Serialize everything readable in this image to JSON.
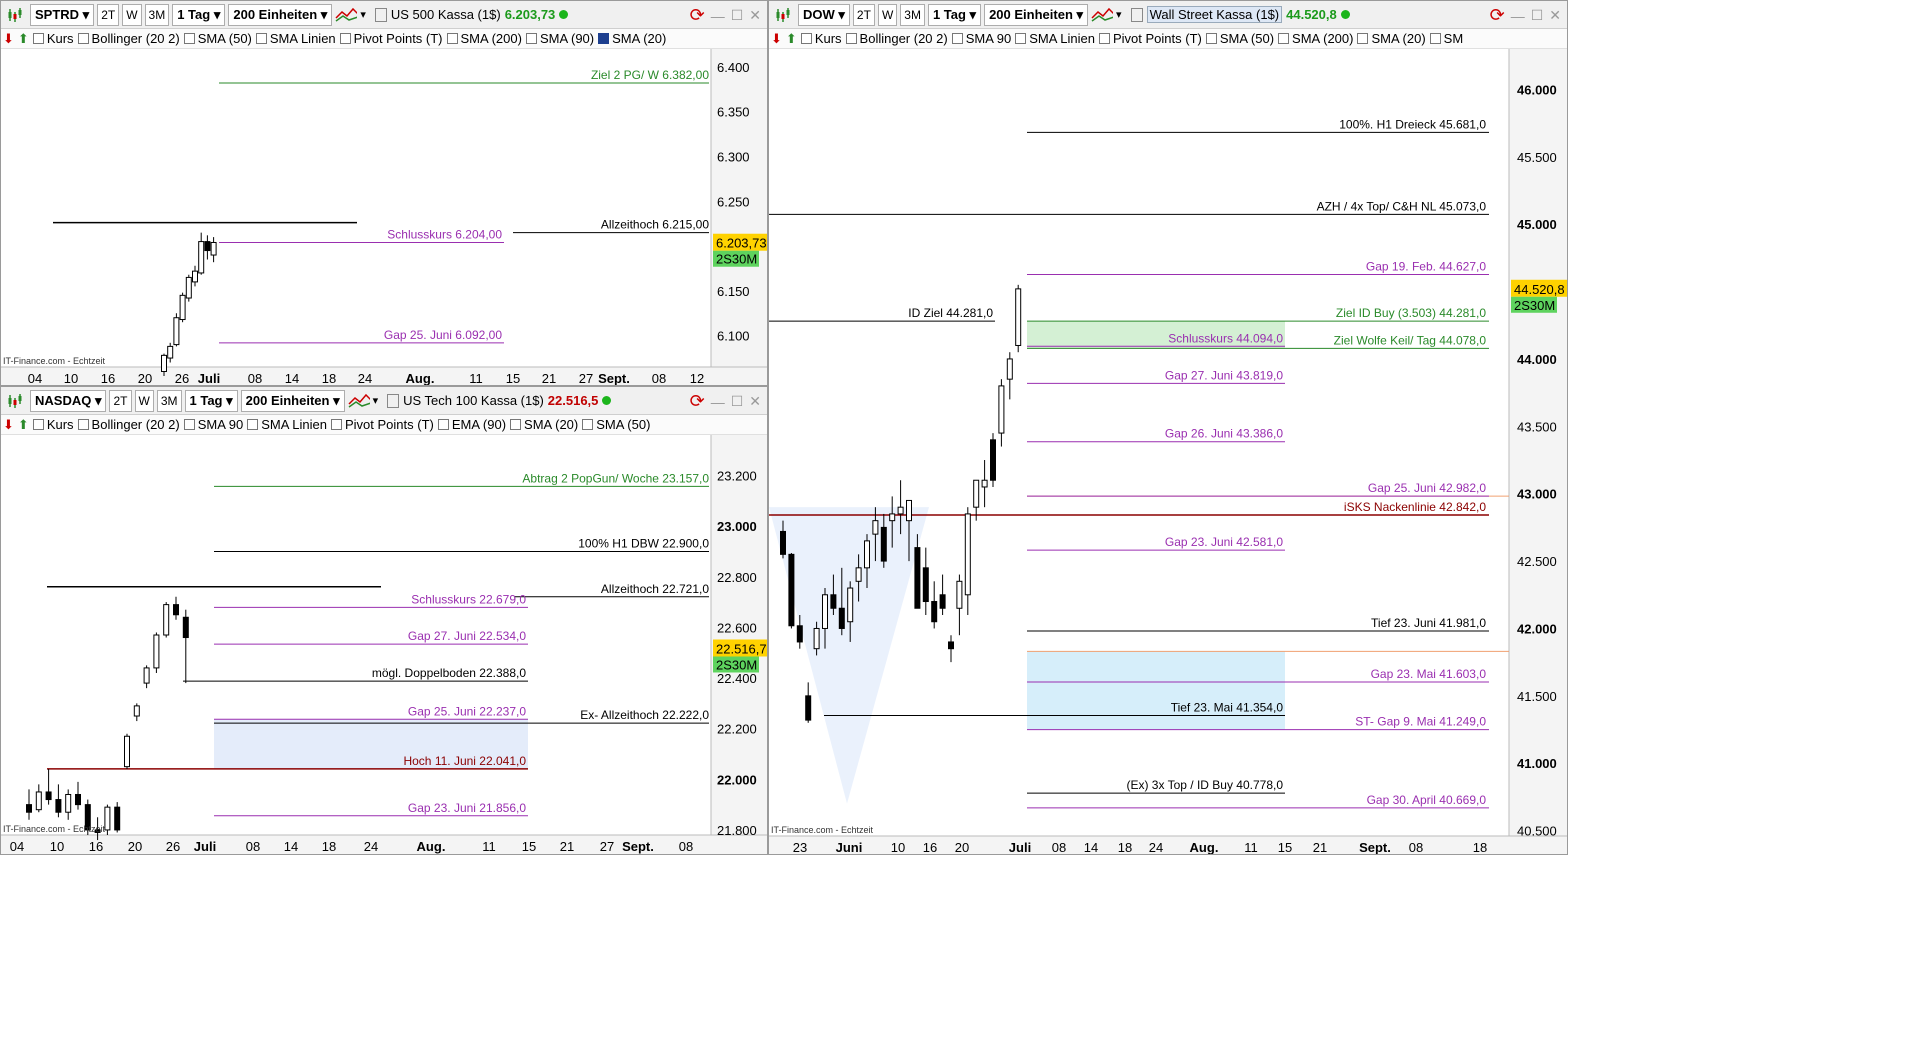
{
  "panels": {
    "sp": {
      "symbol": "SPTRD",
      "periods": [
        "2T",
        "W",
        "3M"
      ],
      "interval": "1 Tag",
      "units": "200 Einheiten",
      "instrument": "US 500 Kassa (1$)",
      "price": "6.203,73",
      "indicators": [
        "Kurs",
        "Bollinger (20 2)",
        "SMA (50)",
        "SMA Linien",
        "Pivot Points (T)",
        "SMA (200)",
        "SMA (90)",
        "SMA (20)"
      ],
      "watermark": "IT-Finance.com - Echtzeit",
      "price_tag": "6.203,73",
      "tag_sub": "2S30M"
    },
    "nq": {
      "symbol": "NASDAQ",
      "periods": [
        "2T",
        "W",
        "3M"
      ],
      "interval": "1 Tag",
      "units": "200 Einheiten",
      "instrument": "US Tech 100 Kassa (1$)",
      "price": "22.516,5",
      "indicators": [
        "Kurs",
        "Bollinger (20 2)",
        "SMA 90",
        "SMA Linien",
        "Pivot Points (T)",
        "EMA (90)",
        "SMA (20)",
        "SMA (50)"
      ],
      "watermark": "IT-Finance.com - Echtzeit",
      "price_tag": "22.516,7",
      "tag_sub": "2S30M"
    },
    "dow": {
      "symbol": "DOW",
      "periods": [
        "2T",
        "W",
        "3M"
      ],
      "interval": "1 Tag",
      "units": "200 Einheiten",
      "instrument": "Wall Street Kassa (1$)",
      "price": "44.520,8",
      "indicators": [
        "Kurs",
        "Bollinger (20 2)",
        "SMA 90",
        "SMA Linien",
        "Pivot Points (T)",
        "SMA (50)",
        "SMA (200)",
        "SMA (20)",
        "SM"
      ],
      "watermark": "IT-Finance.com - Echtzeit",
      "price_tag": "44.520,8",
      "tag_sub": "2S30M"
    }
  },
  "colors": {
    "green": "#2a8a2a",
    "purple": "#9a2fb0",
    "black": "#000000",
    "darkred": "#8b0000",
    "orange": "#f0a070",
    "up": "#ffffff",
    "down": "#000000",
    "tag": "#ffd200",
    "tag2": "#5ed35e"
  },
  "chart_data": [
    {
      "type": "line",
      "name": "SPTRD",
      "ylim": [
        6065,
        6420
      ],
      "yticks": [
        6100,
        6150,
        6200,
        6250,
        6300,
        6350,
        6400
      ],
      "ytick_labels": [
        "6.100",
        "6.150",
        "",
        "6.250",
        "6.300",
        "6.350",
        "6.400"
      ],
      "xticks": [
        "04",
        "10",
        "16",
        "20",
        "26",
        "Juli",
        "08",
        "14",
        "18",
        "24",
        "Aug.",
        "11",
        "15",
        "21",
        "27",
        "Sept.",
        "08",
        "12"
      ],
      "levels": [
        {
          "label": "Ziel 2 PG/ W  6.382,00",
          "value": 6382,
          "color": "green"
        },
        {
          "label": "Allzeithoch  6.215,00",
          "value": 6215,
          "color": "black"
        },
        {
          "label": "Schlusskurs 6.204,00",
          "value": 6204,
          "color": "purple"
        },
        {
          "label": "Gap 25. Juni  6.092,00",
          "value": 6092,
          "color": "purple"
        }
      ],
      "candles": [
        [
          6060,
          6080,
          6055,
          6078
        ],
        [
          6075,
          6092,
          6070,
          6088
        ],
        [
          6090,
          6125,
          6088,
          6120
        ],
        [
          6118,
          6148,
          6115,
          6145
        ],
        [
          6142,
          6168,
          6138,
          6165
        ],
        [
          6160,
          6178,
          6155,
          6172
        ],
        [
          6170,
          6215,
          6168,
          6205
        ],
        [
          6205,
          6212,
          6185,
          6195
        ],
        [
          6190,
          6210,
          6182,
          6204
        ]
      ]
    },
    {
      "type": "line",
      "name": "NASDAQ",
      "ylim": [
        21780,
        23360
      ],
      "yticks": [
        21800,
        22000,
        22200,
        22400,
        22600,
        22800,
        23000,
        23200
      ],
      "ytick_labels": [
        "21.800",
        "22.000",
        "22.200",
        "22.400",
        "22.600",
        "22.800",
        "23.000",
        "23.200"
      ],
      "xticks": [
        "04",
        "10",
        "16",
        "20",
        "26",
        "Juli",
        "08",
        "14",
        "18",
        "24",
        "Aug.",
        "11",
        "15",
        "21",
        "27",
        "Sept.",
        "08"
      ],
      "levels": [
        {
          "label": "Abtrag 2 PopGun/ Woche 23.157,0",
          "value": 23157,
          "color": "green"
        },
        {
          "label": "100%  H1 DBW 22.900,0",
          "value": 22900,
          "color": "black"
        },
        {
          "label": "Allzeithoch 22.721,0",
          "value": 22721,
          "color": "black"
        },
        {
          "label": "Schlusskurs  22.679,0",
          "value": 22679,
          "color": "purple"
        },
        {
          "label": "Gap 27. Juni 22.534,0",
          "value": 22534,
          "color": "purple"
        },
        {
          "label": "mögl. Doppelboden 22.388,0",
          "value": 22388,
          "color": "black"
        },
        {
          "label": "Gap 25. Juni 22.237,0",
          "value": 22237,
          "color": "purple"
        },
        {
          "label": "Ex- Allzeithoch 22.222,0",
          "value": 22222,
          "color": "black"
        },
        {
          "label": "Hoch 11. Juni 22.041,0",
          "value": 22041,
          "color": "darkred"
        },
        {
          "label": "Gap 23. Juni 21.856,0",
          "value": 21856,
          "color": "purple"
        }
      ],
      "candles": [
        [
          21900,
          21960,
          21840,
          21870
        ],
        [
          21880,
          21980,
          21870,
          21950
        ],
        [
          21950,
          22041,
          21900,
          21920
        ],
        [
          21920,
          21980,
          21850,
          21870
        ],
        [
          21870,
          21960,
          21840,
          21940
        ],
        [
          21940,
          21990,
          21880,
          21900
        ],
        [
          21900,
          21920,
          21780,
          21800
        ],
        [
          21800,
          21850,
          21760,
          21790
        ],
        [
          21800,
          21900,
          21780,
          21890
        ],
        [
          21890,
          21910,
          21790,
          21800
        ],
        [
          22050,
          22180,
          22040,
          22170
        ],
        [
          22250,
          22300,
          22230,
          22290
        ],
        [
          22380,
          22450,
          22360,
          22440
        ],
        [
          22440,
          22580,
          22420,
          22570
        ],
        [
          22570,
          22700,
          22560,
          22690
        ],
        [
          22690,
          22721,
          22630,
          22650
        ],
        [
          22640,
          22670,
          22380,
          22560
        ]
      ]
    },
    {
      "type": "line",
      "name": "DOW",
      "ylim": [
        40460,
        46300
      ],
      "yticks": [
        40500,
        41000,
        41500,
        42000,
        42500,
        43000,
        43500,
        44000,
        44500,
        45000,
        45500,
        46000
      ],
      "ytick_labels": [
        "40.500",
        "41.000",
        "41.500",
        "42.000",
        "42.500",
        "43.000",
        "43.500",
        "44.000",
        "",
        "45.000",
        "45.500",
        "46.000"
      ],
      "xticks": [
        "23",
        "Juni",
        "10",
        "16",
        "20",
        "Juli",
        "08",
        "14",
        "18",
        "24",
        "Aug.",
        "11",
        "15",
        "21",
        "Sept.",
        "08",
        "18"
      ],
      "levels": [
        {
          "label": "100%. H1 Dreieck  45.681,0",
          "value": 45681,
          "color": "black"
        },
        {
          "label": "AZH / 4x Top/ C&H NL 45.073,0",
          "value": 45073,
          "color": "black"
        },
        {
          "label": "Gap 19. Feb.  44.627,0",
          "value": 44627,
          "color": "purple"
        },
        {
          "label": "Ziel ID Buy (3.503)  44.281,0",
          "value": 44281,
          "color": "green"
        },
        {
          "label": "ID Ziel 44.281,0",
          "value": 44281,
          "color": "black"
        },
        {
          "label": "Schlusskurs 44.094,0",
          "value": 44094,
          "color": "purple"
        },
        {
          "label": "Ziel Wolfe Keil/ Tag 44.078,0",
          "value": 44078,
          "color": "green"
        },
        {
          "label": "Gap 27. Juni 43.819,0",
          "value": 43819,
          "color": "purple"
        },
        {
          "label": "Gap 26. Juni 43.386,0",
          "value": 43386,
          "color": "purple"
        },
        {
          "label": "Gap 25. Juni 42.982,0",
          "value": 42982,
          "color": "purple"
        },
        {
          "label": "iSKS Nackenlinie 42.842,0",
          "value": 42842,
          "color": "darkred"
        },
        {
          "label": "Gap 23. Juni 42.581,0",
          "value": 42581,
          "color": "purple"
        },
        {
          "label": "Tief 23. Juni  41.981,0",
          "value": 41981,
          "color": "black"
        },
        {
          "label": "Gap  23. Mai 41.603,0",
          "value": 41603,
          "color": "purple"
        },
        {
          "label": "Tief  23. Mai 41.354,0",
          "value": 41354,
          "color": "black"
        },
        {
          "label": "ST- Gap 9. Mai  41.249,0",
          "value": 41249,
          "color": "purple"
        },
        {
          "label": "(Ex) 3x Top /  ID Buy  40.778,0",
          "value": 40778,
          "color": "black"
        },
        {
          "label": "Gap 30. April 40.669,0",
          "value": 40669,
          "color": "purple"
        }
      ],
      "candles": [
        [
          42720,
          42800,
          42520,
          42550
        ],
        [
          42550,
          42560,
          42000,
          42020
        ],
        [
          42020,
          42100,
          41850,
          41900
        ],
        [
          41500,
          41600,
          41300,
          41320
        ],
        [
          41850,
          42050,
          41800,
          42000
        ],
        [
          42000,
          42300,
          41850,
          42250
        ],
        [
          42250,
          42400,
          42100,
          42150
        ],
        [
          42150,
          42450,
          41950,
          42000
        ],
        [
          42050,
          42350,
          41900,
          42300
        ],
        [
          42350,
          42550,
          42200,
          42450
        ],
        [
          42450,
          42700,
          42300,
          42650
        ],
        [
          42700,
          42900,
          42500,
          42800
        ],
        [
          42750,
          42850,
          42450,
          42500
        ],
        [
          42800,
          42980,
          42600,
          42850
        ],
        [
          42850,
          43100,
          42700,
          42900
        ],
        [
          42800,
          42950,
          42500,
          42950
        ],
        [
          42600,
          42700,
          42250,
          42150
        ],
        [
          42450,
          42600,
          42100,
          42200
        ],
        [
          42200,
          42350,
          42000,
          42050
        ],
        [
          42250,
          42400,
          42100,
          42150
        ],
        [
          41900,
          41950,
          41750,
          41850
        ],
        [
          42150,
          42400,
          41950,
          42350
        ],
        [
          42250,
          42900,
          42100,
          42850
        ],
        [
          42900,
          43050,
          42800,
          43100
        ],
        [
          43050,
          43250,
          42900,
          43100
        ],
        [
          43400,
          43450,
          43050,
          43100
        ],
        [
          43450,
          43850,
          43350,
          43800
        ],
        [
          43850,
          44050,
          43700,
          44000
        ],
        [
          44100,
          44550,
          44050,
          44520
        ]
      ]
    }
  ]
}
